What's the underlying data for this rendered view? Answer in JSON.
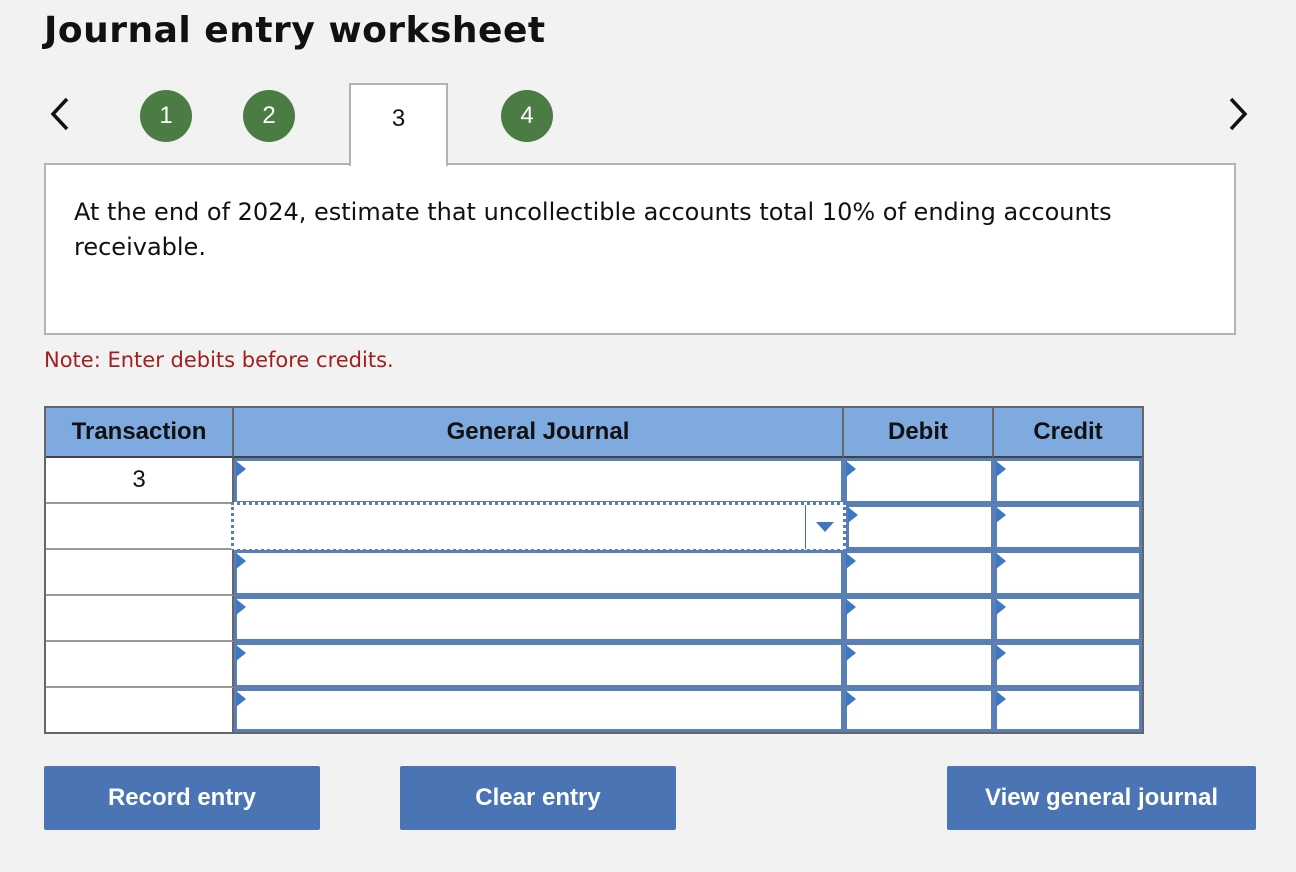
{
  "title": "Journal entry worksheet",
  "nav": {
    "prev_icon": "chevron-left-icon",
    "next_icon": "chevron-right-icon",
    "steps": [
      {
        "label": "1",
        "state": "completed"
      },
      {
        "label": "2",
        "state": "completed"
      },
      {
        "label": "3",
        "state": "current"
      },
      {
        "label": "4",
        "state": "completed"
      }
    ]
  },
  "prompt": "At the end of 2024, estimate that uncollectible accounts total 10% of ending accounts receivable.",
  "note": "Note: Enter debits before credits.",
  "table": {
    "headers": {
      "transaction": "Transaction",
      "general_journal": "General Journal",
      "debit": "Debit",
      "credit": "Credit"
    },
    "rows": [
      {
        "transaction": "3",
        "account": "",
        "debit": "",
        "credit": ""
      },
      {
        "transaction": "",
        "account": "",
        "debit": "",
        "credit": ""
      },
      {
        "transaction": "",
        "account": "",
        "debit": "",
        "credit": ""
      },
      {
        "transaction": "",
        "account": "",
        "debit": "",
        "credit": ""
      },
      {
        "transaction": "",
        "account": "",
        "debit": "",
        "credit": ""
      },
      {
        "transaction": "",
        "account": "",
        "debit": "",
        "credit": ""
      }
    ]
  },
  "buttons": {
    "record": "Record entry",
    "clear": "Clear entry",
    "view": "View general journal"
  },
  "colors": {
    "step_completed": "#4a7c43",
    "header_bg": "#7faadf",
    "button_bg": "#4a74b4",
    "note_text": "#a31f1f",
    "input_border": "#5a7fb6"
  }
}
